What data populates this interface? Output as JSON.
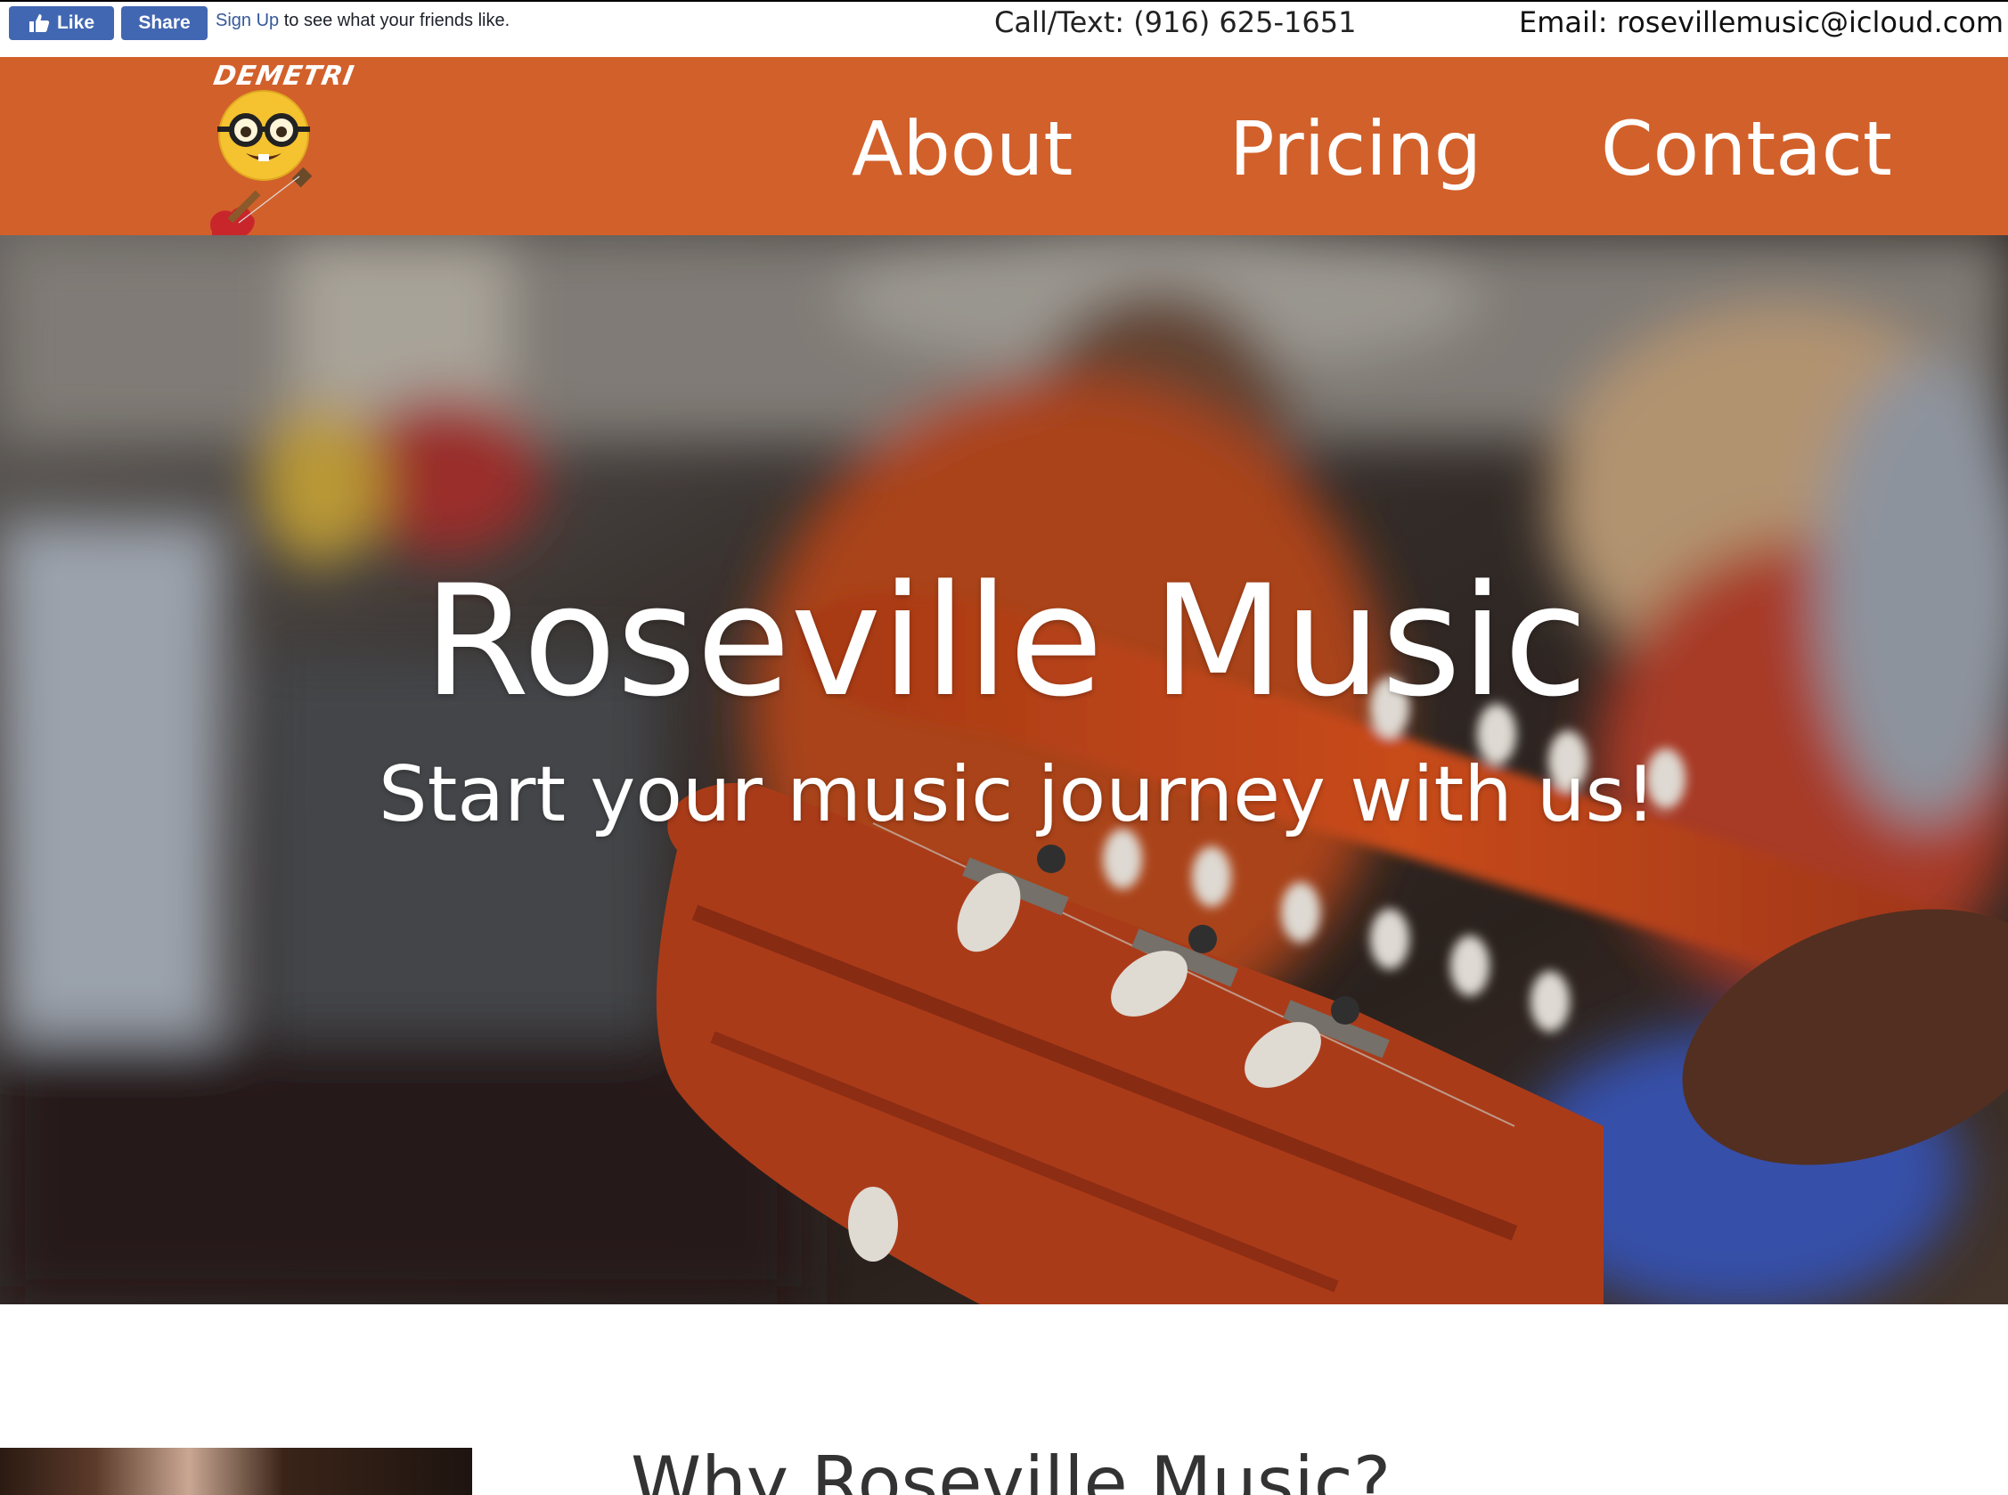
{
  "facebook": {
    "like_label": "Like",
    "share_label": "Share",
    "signup_link": "Sign Up",
    "social_text": " to see what your friends like.",
    "like_icon": "thumbs-up-icon",
    "brand_color": "#4267b2"
  },
  "contact": {
    "phone": "Call/Text: (916) 625-1651",
    "email": "Email: rosevillemusic@icloud.com"
  },
  "logo": {
    "text": "DEMETRI",
    "icon": "nerd-face-guitar-icon"
  },
  "nav": {
    "items": [
      {
        "label": "About"
      },
      {
        "label": "Pricing"
      },
      {
        "label": "Contact"
      }
    ],
    "background_color": "#d2602a"
  },
  "hero": {
    "title": "Roseville Music",
    "subtitle": "Start your music journey with us!"
  },
  "section": {
    "heading": "Why Roseville Music?"
  }
}
